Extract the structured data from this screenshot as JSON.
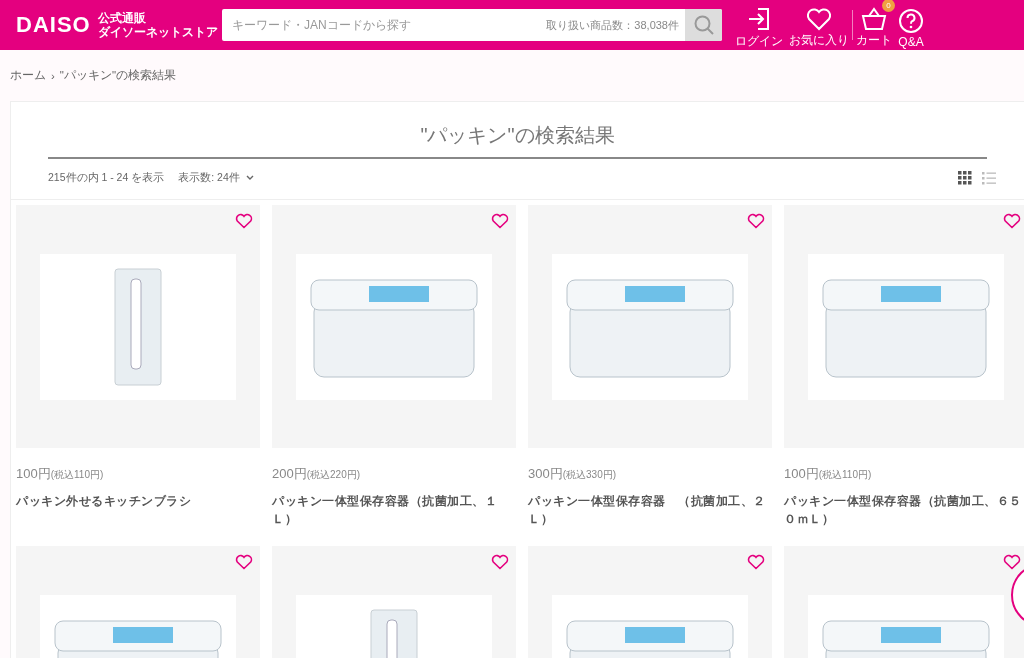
{
  "header": {
    "logo": "DAISO",
    "store_name_line1": "公式通販",
    "store_name_line2": "ダイソーネットストア",
    "search": {
      "placeholder": "キーワード・JANコードから探す",
      "item_count": "取り扱い商品数：38,038件"
    },
    "nav": [
      {
        "kind": "login",
        "label": "ログイン"
      },
      {
        "kind": "favorite",
        "label": "お気に入り"
      },
      {
        "kind": "cart",
        "label": "カート",
        "badge": "0"
      },
      {
        "kind": "help",
        "label": "Q&A"
      }
    ]
  },
  "breadcrumb": [
    {
      "label": "ホーム"
    },
    {
      "label": "\"パッキン\"の検索結果"
    }
  ],
  "breadcrumb_separator": "›",
  "results": {
    "title": "\"パッキン\"の検索結果",
    "summary": "215件の内 1 - 24 を表示",
    "per_page": "表示数: 24件",
    "view_modes": [
      {
        "kind": "grid",
        "selected": true
      },
      {
        "kind": "list",
        "selected": false
      }
    ],
    "products": [
      {
        "kind": "tool",
        "price": "100円",
        "tax_price": "(税込110円)",
        "name": "パッキン外せるキッチンブラシ"
      },
      {
        "kind": "container",
        "price": "200円",
        "tax_price": "(税込220円)",
        "name": "パッキン一体型保存容器（抗菌加工、１Ｌ）"
      },
      {
        "kind": "container",
        "price": "300円",
        "tax_price": "(税込330円)",
        "name": "パッキン一体型保存容器　（抗菌加工、２Ｌ）"
      },
      {
        "kind": "container",
        "price": "100円",
        "tax_price": "(税込110円)",
        "name": "パッキン一体型保存容器（抗菌加工、６５０ｍＬ）"
      },
      {
        "kind": "container"
      },
      {
        "kind": "tool"
      },
      {
        "kind": "container"
      },
      {
        "kind": "container"
      }
    ]
  }
}
